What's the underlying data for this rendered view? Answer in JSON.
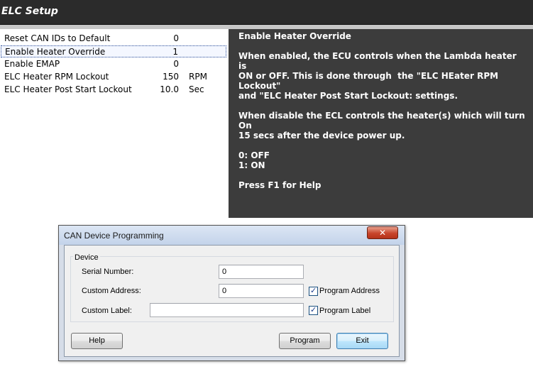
{
  "elc": {
    "title": "ELC Setup",
    "settings": [
      {
        "label": "Reset CAN IDs to Default",
        "value": "0",
        "unit": ""
      },
      {
        "label": "Enable Heater Override",
        "value": "1",
        "unit": ""
      },
      {
        "label": "Enable EMAP",
        "value": "0",
        "unit": ""
      },
      {
        "label": "ELC Heater RPM Lockout",
        "value": "150",
        "unit": "RPM"
      },
      {
        "label": "ELC Heater Post Start Lockout",
        "value": "10.0",
        "unit": "Sec"
      }
    ],
    "help": {
      "heading": "Enable Heater Override",
      "para1": "When enabled, the ECU controls when the Lambda heater is\nON or OFF. This is done through  the \"ELC HEater RPM Lockout\"\nand \"ELC Heater Post Start Lockout: settings.",
      "para2": "When disable the ECL controls the heater(s) which will turn On\n15 secs after the device power up.",
      "para3": "0: OFF\n1: ON",
      "para4": "Press F1 for Help"
    }
  },
  "dialog": {
    "title": "CAN Device Programming",
    "close_glyph": "✕",
    "group_label": "Device",
    "serial_label": "Serial Number:",
    "serial_value": "0",
    "address_label": "Custom Address:",
    "address_value": "0",
    "program_address_label": "Program Address",
    "custom_label_label": "Custom Label:",
    "custom_label_value": "",
    "program_label_label": "Program Label",
    "check_glyph": "✓",
    "help_button": "Help",
    "program_button": "Program",
    "exit_button": "Exit"
  }
}
